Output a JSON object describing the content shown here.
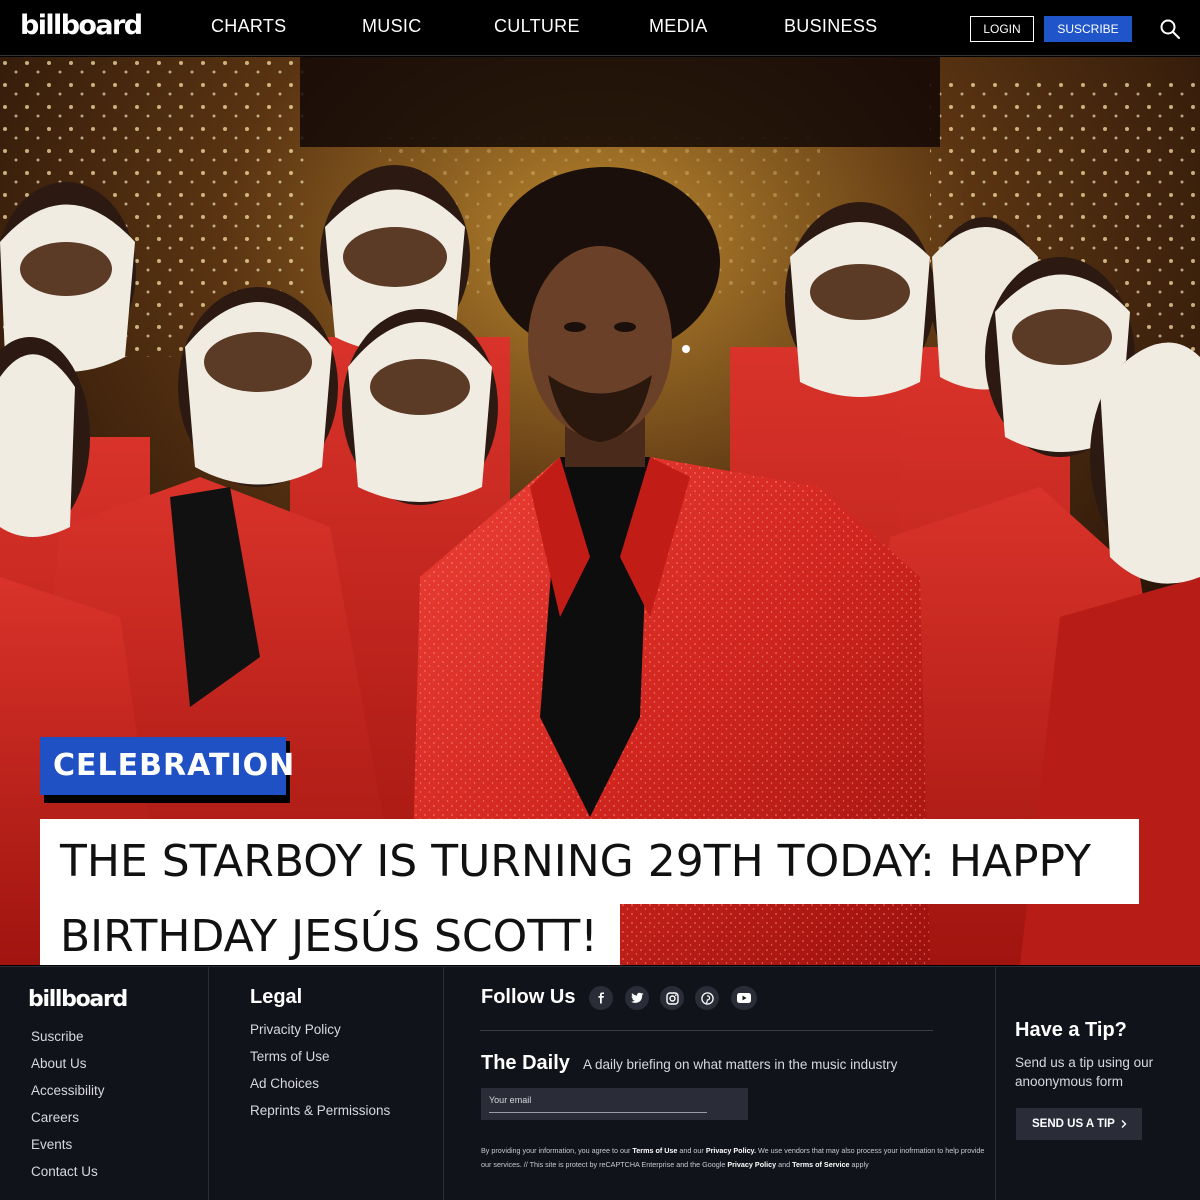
{
  "nav": {
    "logo": "billboard",
    "items": [
      "CHARTS",
      "MUSIC",
      "CULTURE",
      "MEDIA",
      "BUSINESS"
    ],
    "login_label": "LOGIN",
    "subscribe_label": "SUSCRIBE",
    "search_icon": "search-icon"
  },
  "hero": {
    "category": "CELEBRATION",
    "headline_line1": "THE STARBOY IS TURNING 29TH TODAY: HAPPY",
    "headline_line2": "BIRTHDAY JESÚS SCOTT!"
  },
  "footer": {
    "logo": "billboard",
    "links": [
      "Suscribe",
      "About Us",
      "Accessibility",
      "Careers",
      "Events",
      "Contact Us"
    ],
    "legal": {
      "heading": "Legal",
      "links": [
        "Privacity Policy",
        "Terms of Use",
        "Ad Choices",
        "Reprints & Permissions"
      ]
    },
    "follow": {
      "heading": "Follow Us",
      "icons": [
        "facebook-icon",
        "twitter-icon",
        "instagram-icon",
        "pinterest-icon",
        "youtube-icon"
      ]
    },
    "daily": {
      "title": "The Daily",
      "description": "A daily briefing on what matters in the music industry",
      "email_placeholder": "Your email"
    },
    "legal_note": {
      "p1": "By providing your information, you agree to our ",
      "terms": "Terms of Use",
      "p2": " and our ",
      "privacy": "Privacy Policy.",
      "p3": " We use vendors that may also process your inofrmation to help provide our services. // This site is protect by reCAPTCHA Enterprise and the Google ",
      "privacy2": "Privacy Policy",
      "p4": " and ",
      "tos": "Terms of Service",
      "p5": " apply"
    },
    "tip": {
      "heading": "Have a Tip?",
      "description": "Send us a tip using our anoonymous form",
      "button_label": "SEND US A TIP"
    }
  },
  "colors": {
    "accent_blue": "#1f50c4",
    "footer_bg": "#11131b",
    "jacket_red": "#c8231e"
  }
}
